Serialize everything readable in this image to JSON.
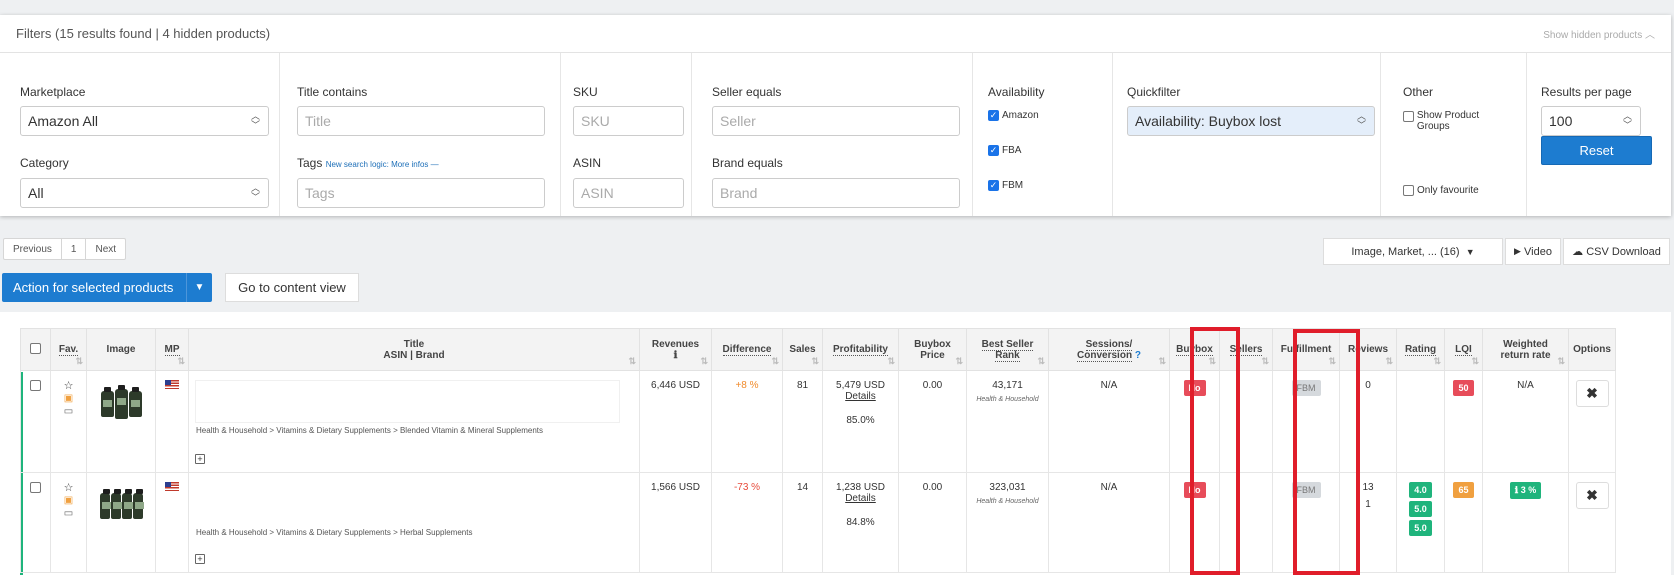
{
  "filters": {
    "title": "Filters",
    "summary": "(15 results found | 4 hidden products)",
    "show_hidden": "Show hidden products",
    "marketplace": {
      "label": "Marketplace",
      "value": "Amazon All"
    },
    "category": {
      "label": "Category",
      "value": "All"
    },
    "title_contains": {
      "label": "Title contains",
      "placeholder": "Title"
    },
    "tags": {
      "label": "Tags",
      "hint": "New search logic: More infos —",
      "placeholder": "Tags"
    },
    "sku": {
      "label": "SKU",
      "placeholder": "SKU"
    },
    "asin": {
      "label": "ASIN",
      "placeholder": "ASIN"
    },
    "seller": {
      "label": "Seller equals",
      "placeholder": "Seller"
    },
    "brand": {
      "label": "Brand equals",
      "placeholder": "Brand"
    },
    "availability": {
      "label": "Availability",
      "options": [
        "Amazon",
        "FBA",
        "FBM"
      ]
    },
    "quickfilter": {
      "label": "Quickfilter",
      "value": "Availability: Buybox lost"
    },
    "other": {
      "label": "Other",
      "show_groups": "Show Product Groups",
      "only_favourite": "Only favourite"
    },
    "results_per_page": {
      "label": "Results per page",
      "value": "100"
    },
    "reset": "Reset"
  },
  "pager": {
    "previous": "Previous",
    "page": "1",
    "next": "Next"
  },
  "toolbar": {
    "columns": "Image,  Market, ... (16)",
    "video": "Video",
    "csv": "CSV Download",
    "action": "Action for selected products",
    "content_view": "Go to content view"
  },
  "table": {
    "headers": {
      "fav": "Fav.",
      "image": "Image",
      "mp": "MP",
      "title": "Title",
      "title_sub": "ASIN | Brand",
      "revenues": "Revenues",
      "difference": "Difference",
      "sales": "Sales",
      "profitability": "Profitability",
      "buybox_price_1": "Buybox",
      "buybox_price_2": "Price",
      "bsr_1": "Best Seller",
      "bsr_2": "Rank",
      "sessions_1": "Sessions/",
      "sessions_2": "Conversion",
      "buybox": "Buybox",
      "sellers": "Sellers",
      "fulfillment": "Fulfillment",
      "reviews": "Reviews",
      "rating": "Rating",
      "lqi": "LQI",
      "return_1": "Weighted",
      "return_2": "return rate",
      "options": "Options"
    },
    "rows": [
      {
        "category_path": "Health & Household > Vitamins & Dietary Supplements > Blended Vitamin & Mineral Supplements",
        "revenues": "6,446 USD",
        "difference": "+8 %",
        "sales": "81",
        "profit": "5,479 USD",
        "details": "Details",
        "profit_pct": "85.0%",
        "buybox_price": "0.00",
        "bsr": "43,171",
        "bsr_cat": "Health & Household",
        "sessions": "N/A",
        "buybox": "No",
        "fulfillment": "FBM",
        "reviews": "0",
        "reviews2": "",
        "ratings": [],
        "lqi": "50",
        "return_rate": "N/A"
      },
      {
        "category_path": "Health & Household > Vitamins & Dietary Supplements > Herbal Supplements",
        "revenues": "1,566 USD",
        "difference": "-73 %",
        "sales": "14",
        "profit": "1,238 USD",
        "details": "Details",
        "profit_pct": "84.8%",
        "buybox_price": "0.00",
        "bsr": "323,031",
        "bsr_cat": "Health & Household",
        "sessions": "N/A",
        "buybox": "No",
        "fulfillment": "FBM",
        "reviews": "13",
        "reviews2": "1",
        "ratings": [
          "4.0",
          "5.0",
          "5.0"
        ],
        "lqi": "65",
        "return_rate": "3 %"
      }
    ]
  },
  "colors": {
    "primary": "#1d7cd0",
    "highlight": "#e01d2a",
    "success": "#1fb47c",
    "danger": "#e74c5a",
    "warning": "#f0a040"
  }
}
